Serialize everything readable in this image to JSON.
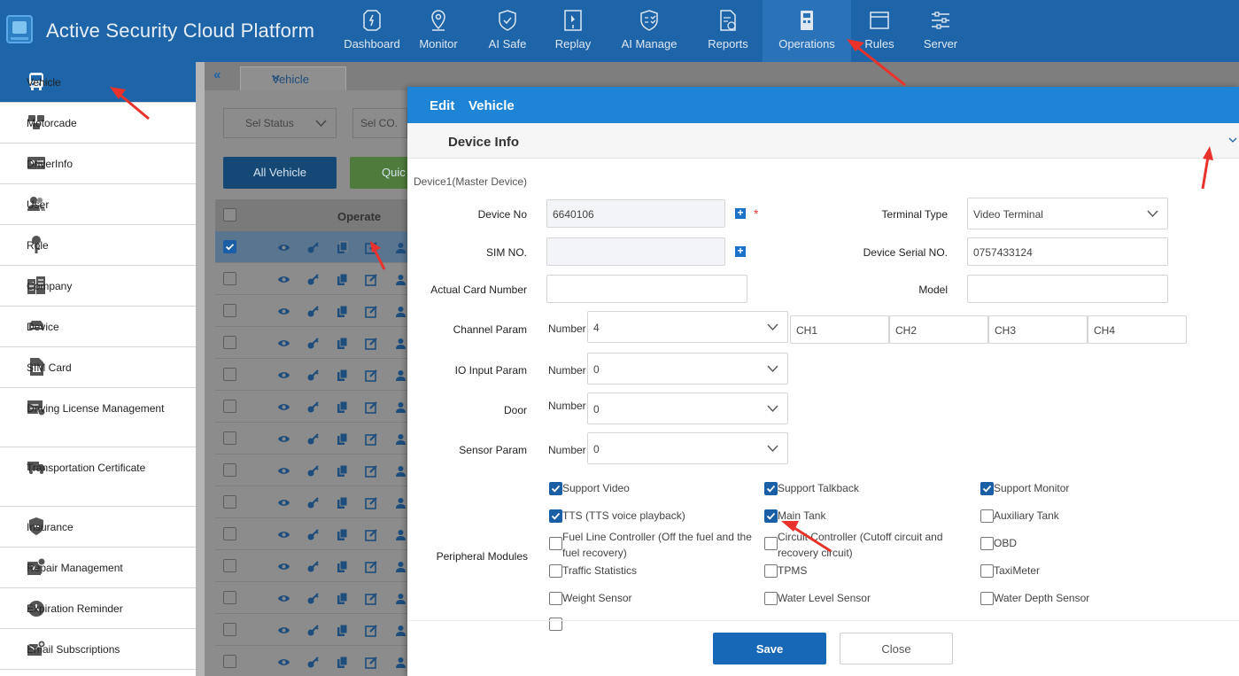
{
  "app": {
    "title": "Active Security Cloud Platform"
  },
  "nav": [
    {
      "label": "Dashboard",
      "icon": "dashboard-icon"
    },
    {
      "label": "Monitor",
      "icon": "location-pin-icon"
    },
    {
      "label": "AI Safe",
      "icon": "shield-check-icon"
    },
    {
      "label": "Replay",
      "icon": "replay-icon"
    },
    {
      "label": "AI Manage",
      "icon": "ai-manage-icon"
    },
    {
      "label": "Reports",
      "icon": "report-icon"
    },
    {
      "label": "Operations",
      "icon": "operations-icon",
      "active": true
    },
    {
      "label": "Rules",
      "icon": "rules-icon"
    },
    {
      "label": "Server",
      "icon": "server-icon"
    }
  ],
  "sidebar": {
    "items": [
      {
        "label": "Vehicle",
        "icon": "bus-icon",
        "active": true
      },
      {
        "label": "Motorcade",
        "icon": "motorcade-icon"
      },
      {
        "label": "DriverInfo",
        "icon": "id-card-icon"
      },
      {
        "label": "User",
        "icon": "users-icon"
      },
      {
        "label": "Role",
        "icon": "key-icon"
      },
      {
        "label": "Company",
        "icon": "building-icon"
      },
      {
        "label": "Device",
        "icon": "device-icon"
      },
      {
        "label": "SIM Card",
        "icon": "sim-card-icon"
      },
      {
        "label": "Driving License Management",
        "icon": "license-icon"
      },
      {
        "label": "Transportation Certificate",
        "icon": "truck-doc-icon"
      },
      {
        "label": "Insurance",
        "icon": "insurance-shield-icon"
      },
      {
        "label": "Repair Management",
        "icon": "wrench-icon"
      },
      {
        "label": "Expiration Reminder",
        "icon": "clock-icon"
      },
      {
        "label": "Email Subscriptions",
        "icon": "email-icon"
      }
    ]
  },
  "background": {
    "collapse": "«",
    "tab": {
      "label": "Vehicle",
      "close": "×"
    },
    "filters": [
      "Sel Status",
      "Sel CO."
    ],
    "buttons": {
      "all": "All Vehicle",
      "quick": "Quic"
    },
    "table": {
      "header": "Operate"
    }
  },
  "modal": {
    "title_action": "Edit",
    "title_entity": "Vehicle",
    "section": "Device Info",
    "sub_title": "Device1(Master Device)",
    "fields": {
      "device_no": {
        "label": "Device No",
        "value": "6640106",
        "required": "*"
      },
      "terminal_type": {
        "label": "Terminal Type",
        "value": "Video Terminal"
      },
      "sim_no": {
        "label": "SIM NO.",
        "value": ""
      },
      "device_serial": {
        "label": "Device Serial NO.",
        "value": "0757433124"
      },
      "actual_card": {
        "label": "Actual Card Number",
        "value": ""
      },
      "model": {
        "label": "Model",
        "value": ""
      },
      "channel_param": {
        "label": "Channel Param",
        "number_label": "Number",
        "value": "4",
        "channels": [
          "CH1",
          "CH2",
          "CH3",
          "CH4"
        ]
      },
      "io_input": {
        "label": "IO Input Param",
        "number_label": "Number",
        "value": "0"
      },
      "door": {
        "label": "Door",
        "number_label": "Number",
        "value": "0"
      },
      "sensor": {
        "label": "Sensor Param",
        "number_label": "Number",
        "value": "0"
      }
    },
    "peripheral": {
      "label": "Peripheral Modules",
      "items": [
        {
          "label": "Support Video",
          "checked": true
        },
        {
          "label": "Support Talkback",
          "checked": true
        },
        {
          "label": "Support Monitor",
          "checked": true
        },
        {
          "label": "TTS (TTS voice playback)",
          "checked": true
        },
        {
          "label": "Main Tank",
          "checked": true
        },
        {
          "label": "Auxiliary Tank",
          "checked": false
        },
        {
          "label": "Fuel Line Controller (Off the fuel and the fuel recovery)",
          "checked": false
        },
        {
          "label": "Circuit Controller (Cutoff circuit and recovery circuit)",
          "checked": false
        },
        {
          "label": "OBD",
          "checked": false
        },
        {
          "label": "Traffic Statistics",
          "checked": false
        },
        {
          "label": "TPMS",
          "checked": false
        },
        {
          "label": "TaxiMeter",
          "checked": false
        },
        {
          "label": "Weight Sensor",
          "checked": false
        },
        {
          "label": "Water Level Sensor",
          "checked": false
        },
        {
          "label": "Water Depth Sensor",
          "checked": false
        }
      ]
    },
    "buttons": {
      "save": "Save",
      "close": "Close"
    }
  },
  "colors": {
    "primary": "#1d64a8",
    "modal_header": "#1e84d6",
    "arrow": "#e8322b"
  }
}
